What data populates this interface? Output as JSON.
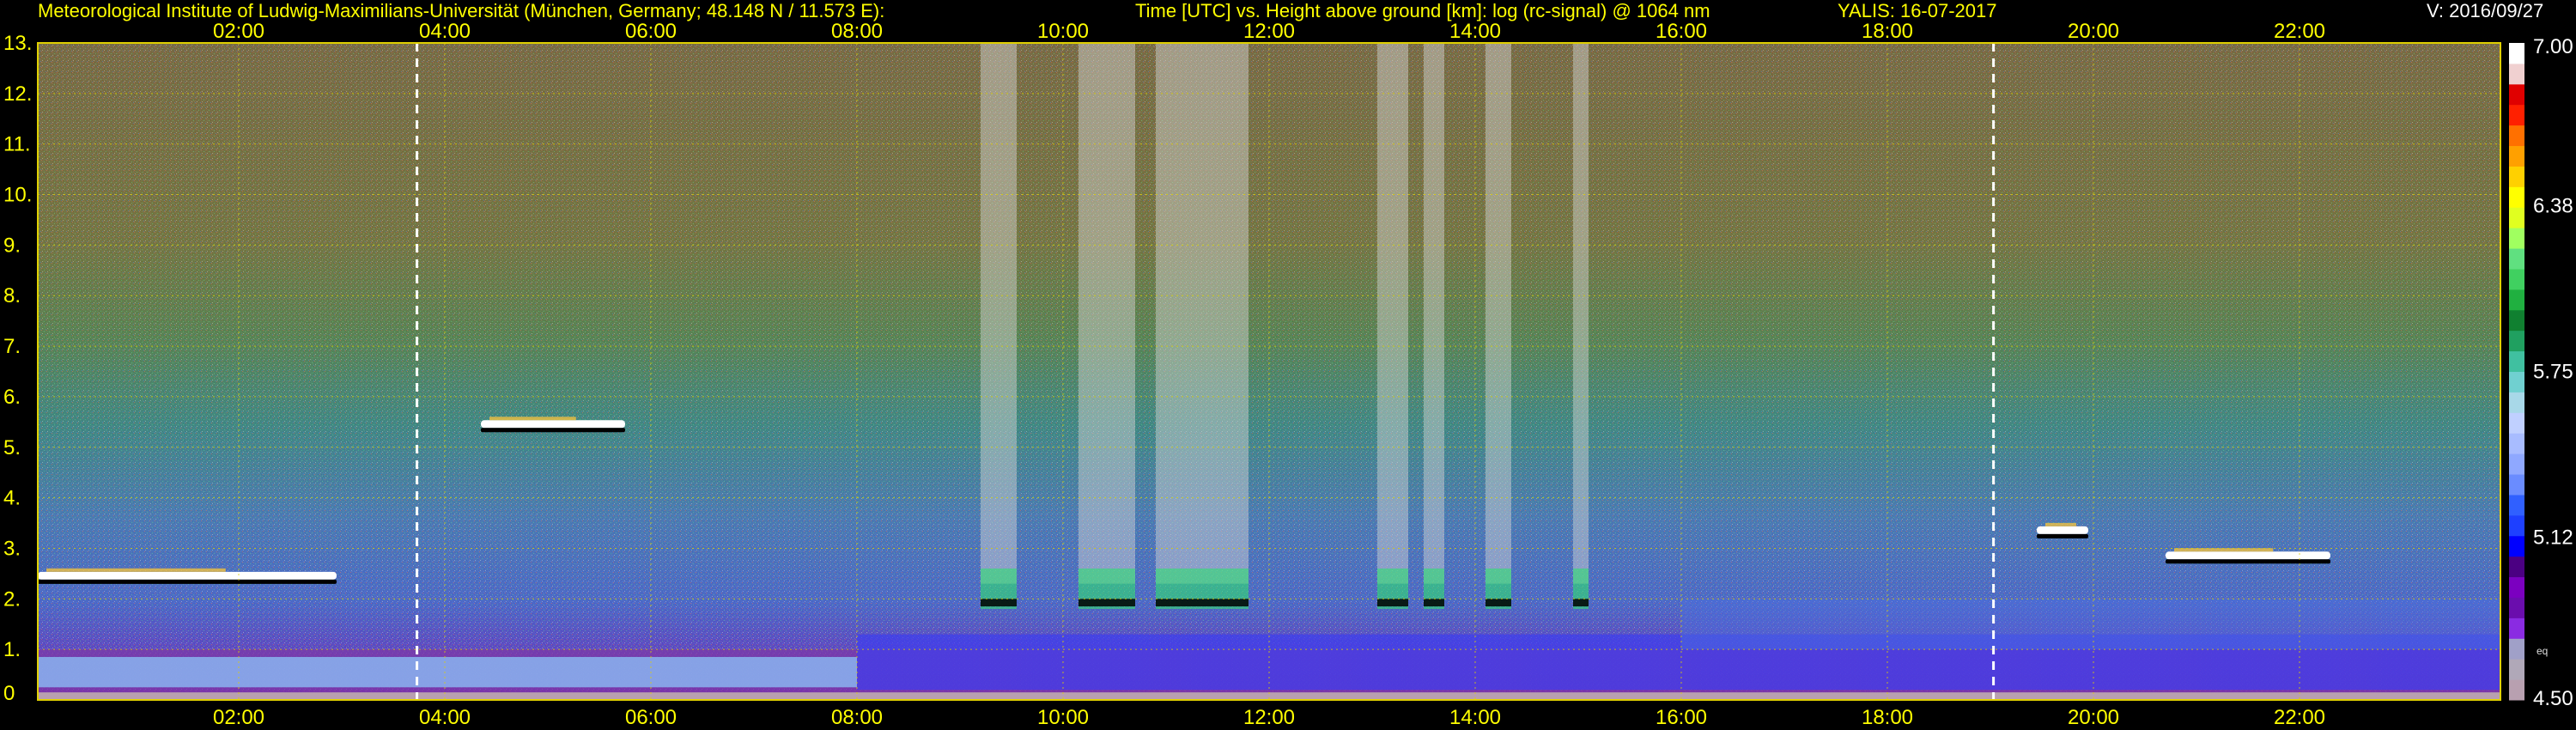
{
  "header": {
    "institute": "Meteorological Institute of Ludwig-Maximilians-Universität (München, Germany; 48.148 N / 11.573 E):",
    "axes_desc": "Time [UTC] vs. Height above ground [km]: log (rc-signal) @ 1064 nm",
    "instrument_date": "YALIS: 16-07-2017",
    "version": "V: 2016/09/27"
  },
  "chart_data": {
    "type": "heatmap",
    "xlabel": "",
    "ylabel": "",
    "x_ticks": [
      "02:00",
      "04:00",
      "06:00",
      "08:00",
      "10:00",
      "12:00",
      "14:00",
      "16:00",
      "18:00",
      "20:00",
      "22:00"
    ],
    "x_tick_hours": [
      2,
      4,
      6,
      8,
      10,
      12,
      14,
      16,
      18,
      20,
      22
    ],
    "xlim_hours": [
      0.05,
      23.95
    ],
    "y_ticks": [
      "0",
      "1.",
      "2.",
      "3.",
      "4.",
      "5.",
      "6.",
      "7.",
      "8.",
      "9.",
      "10.",
      "11.",
      "12.",
      "13."
    ],
    "ylim_km": [
      0,
      13
    ],
    "grid": true,
    "colorbar": {
      "range": [
        4.5,
        7.0
      ],
      "labels": [
        "7.00",
        "6.38",
        "5.75",
        "5.12",
        "4.50"
      ],
      "label_values": [
        7.0,
        6.38,
        5.75,
        5.12,
        4.5
      ],
      "extra_label": "eq",
      "colors": [
        "#b8a0b0",
        "#b0a8b8",
        "#a0a0c8",
        "#8a2be2",
        "#6a0dad",
        "#7b00c0",
        "#4b0082",
        "#0000ff",
        "#1e40ff",
        "#3060ff",
        "#6a8cff",
        "#8fa8ff",
        "#a8bcff",
        "#c0d0ff",
        "#a8d8e8",
        "#70d0d0",
        "#40c0a0",
        "#20a060",
        "#108030",
        "#20b040",
        "#40d060",
        "#60e080",
        "#a0ff60",
        "#e0ff20",
        "#ffff00",
        "#ffd000",
        "#ffa000",
        "#ff7000",
        "#ff2000",
        "#e00000",
        "#f0d0d0",
        "#ffffff"
      ]
    },
    "dashed_lines_hours": [
      3.73,
      19.03
    ],
    "clouds": [
      {
        "t0": 0.05,
        "t1": 2.95,
        "h": 2.45
      },
      {
        "t0": 4.35,
        "t1": 5.75,
        "h": 5.45
      },
      {
        "t0": 19.45,
        "t1": 19.95,
        "h": 3.35
      },
      {
        "t0": 20.7,
        "t1": 22.3,
        "h": 2.85
      }
    ],
    "precip_streaks": [
      {
        "t0": 9.2,
        "t1": 9.55
      },
      {
        "t0": 10.15,
        "t1": 10.7
      },
      {
        "t0": 10.9,
        "t1": 11.8
      },
      {
        "t0": 13.05,
        "t1": 13.35
      },
      {
        "t0": 13.5,
        "t1": 13.7
      },
      {
        "t0": 14.1,
        "t1": 14.35
      },
      {
        "t0": 14.95,
        "t1": 15.1
      }
    ]
  }
}
